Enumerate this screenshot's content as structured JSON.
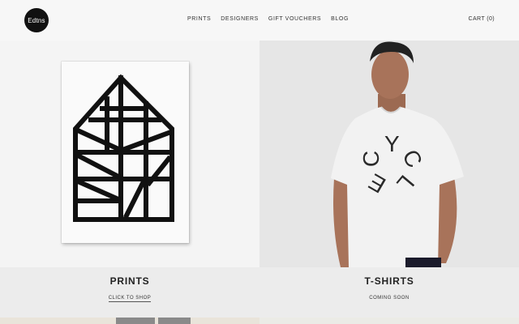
{
  "brand": {
    "logo_text": "Edtns"
  },
  "nav": {
    "items": [
      {
        "label": "PRINTS"
      },
      {
        "label": "DESIGNERS"
      },
      {
        "label": "GIFT VOUCHERS"
      },
      {
        "label": "BLOG"
      }
    ],
    "cart_label": "CART (0)"
  },
  "panels": [
    {
      "title": "PRINTS",
      "subtitle": "CLICK TO SHOP"
    },
    {
      "title": "T-SHIRTS",
      "subtitle": "COMING SOON"
    }
  ],
  "tshirt": {
    "letters": [
      "Y",
      "C",
      "L",
      "E",
      "C"
    ]
  },
  "colors": {
    "logo_bg": "#111111",
    "text": "#222222",
    "caption_bg": "#ececec"
  }
}
